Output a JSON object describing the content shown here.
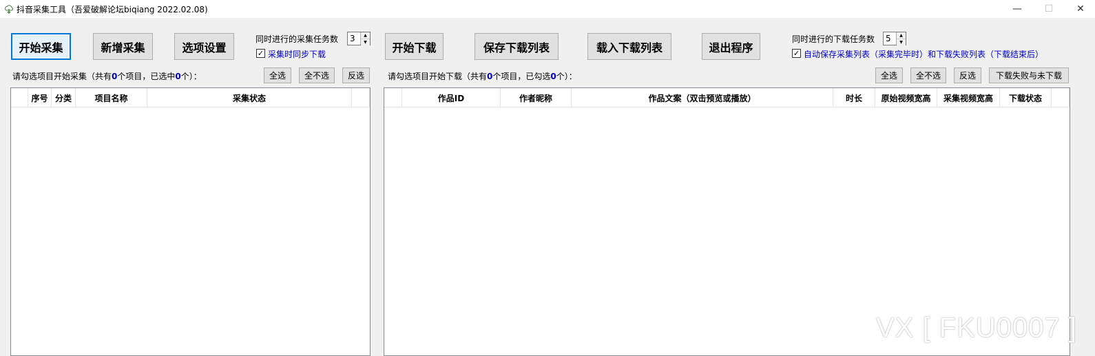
{
  "window": {
    "title": "抖音采集工具（吾爱破解论坛biqiang 2022.02.08)",
    "minimize": "—",
    "maximize": "☐",
    "close": "✕"
  },
  "left_toolbar": {
    "start_collect": "开始采集",
    "add_collect": "新增采集",
    "options": "选项设置",
    "concurrent_label": "同时进行的采集任务数",
    "concurrent_value": "3",
    "sync_download_label": "采集时同步下载",
    "sync_download_checked": true
  },
  "right_toolbar": {
    "start_download": "开始下载",
    "save_list": "保存下载列表",
    "load_list": "载入下载列表",
    "exit": "退出程序",
    "concurrent_label": "同时进行的下载任务数",
    "concurrent_value": "5",
    "autosave_label": "自动保存采集列表（采集完毕时）和下载失败列表（下载结束后）",
    "autosave_checked": true
  },
  "left_panel": {
    "status_prefix": "请勾选项目开始采集（共有",
    "total": "0",
    "status_mid": "个项目，已选中",
    "selected": "0",
    "status_suffix": "个）：",
    "select_all": "全选",
    "select_none": "全不选",
    "invert": "反选",
    "columns": [
      "",
      "序号",
      "分类",
      "项目名称",
      "采集状态",
      ""
    ]
  },
  "right_panel": {
    "status_prefix": "请勾选项目开始下载（共有",
    "total": "0",
    "status_mid": "个项目，已勾选",
    "selected": "0",
    "status_suffix": "个）：",
    "select_all": "全选",
    "select_none": "全不选",
    "invert": "反选",
    "failed_undownloaded": "下载失败与未下载",
    "columns": [
      "",
      "作品ID",
      "作者昵称",
      "作品文案（双击预览或播放）",
      "时长",
      "原始视频宽高",
      "采集视频宽高",
      "下载状态",
      ""
    ]
  },
  "watermark": "VX [ FKU0007 ]"
}
